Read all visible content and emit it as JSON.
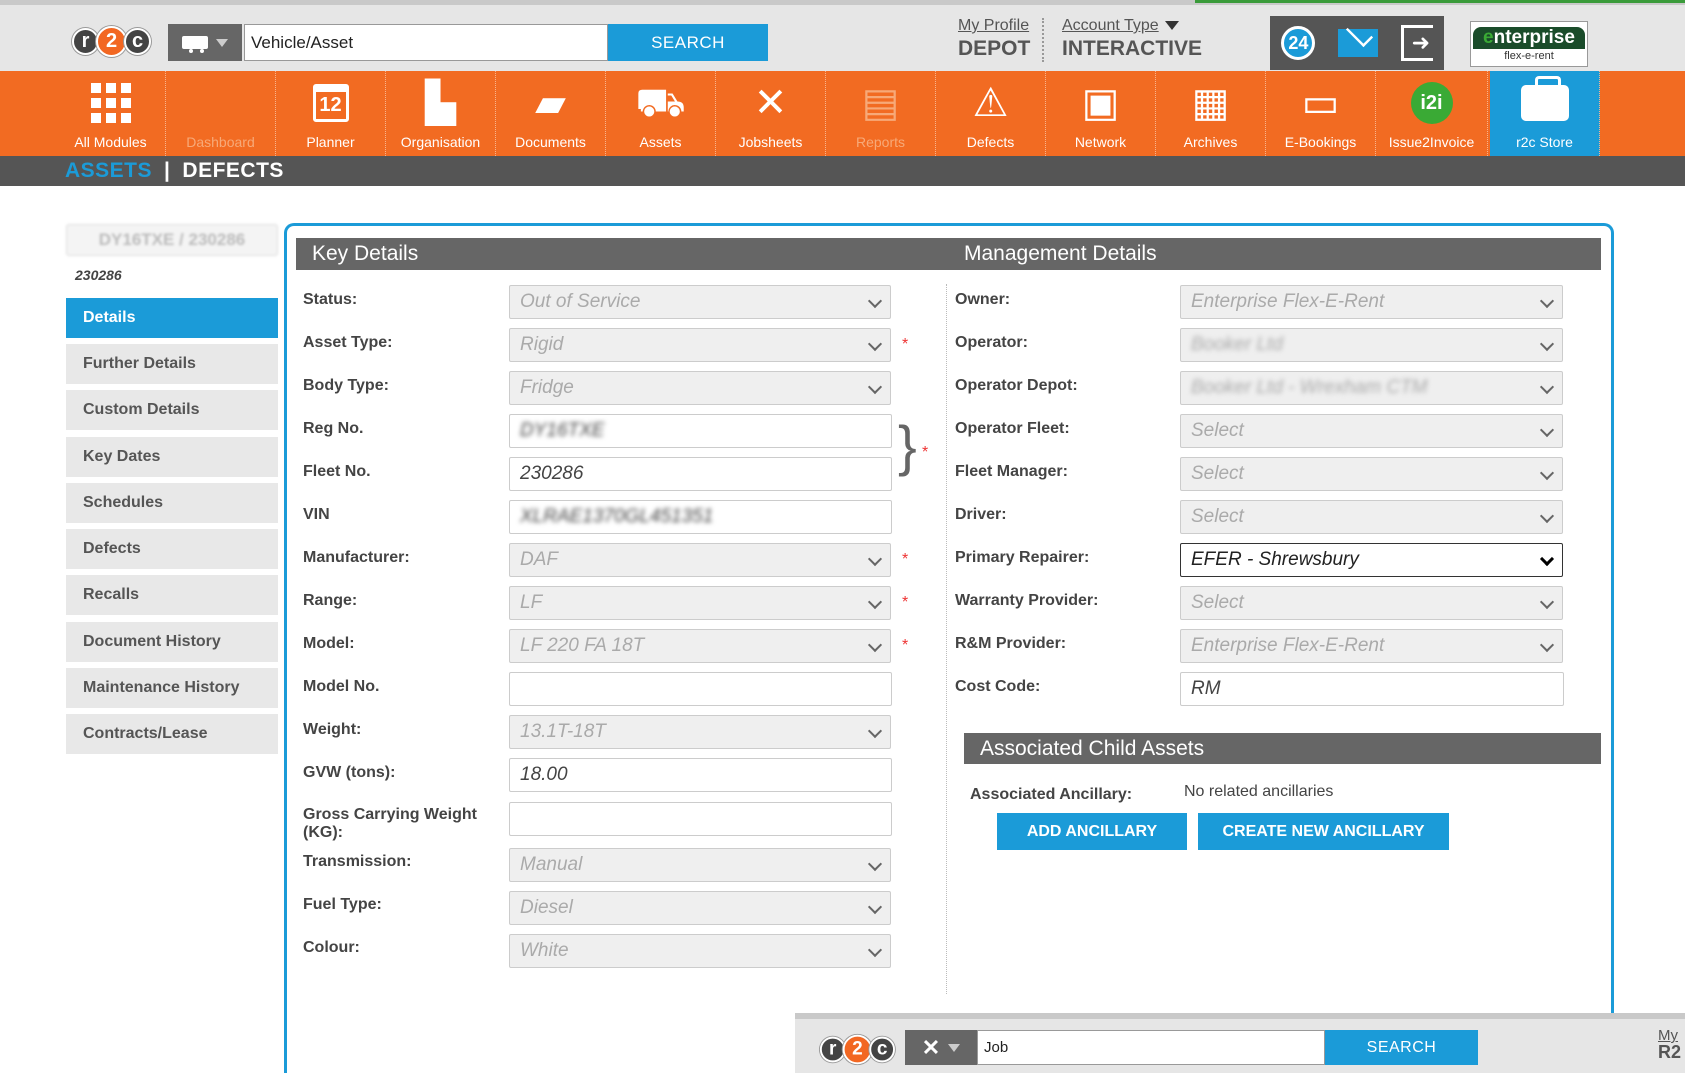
{
  "header": {
    "search_category_icon": "truck-icon",
    "search_value": "Vehicle/Asset",
    "search_button": "SEARCH",
    "my_profile": "My Profile",
    "depot": "DEPOT",
    "account_type": "Account Type",
    "account_value": "INTERACTIVE",
    "notifications_badge": "24",
    "partner_logo_main": "nterprise",
    "partner_logo_first": "e",
    "partner_logo_sub": "flex-e-rent"
  },
  "modules": [
    {
      "label": "All Modules",
      "icon": "grid-icon"
    },
    {
      "label": "Dashboard",
      "icon": "dashboard-icon"
    },
    {
      "label": "Planner",
      "icon": "calendar-icon",
      "icon_text": "12"
    },
    {
      "label": "Organisation",
      "icon": "buildings-icon"
    },
    {
      "label": "Documents",
      "icon": "folder-icon"
    },
    {
      "label": "Assets",
      "icon": "truck-icon"
    },
    {
      "label": "Jobsheets",
      "icon": "tools-icon"
    },
    {
      "label": "Reports",
      "icon": "clipboard-icon"
    },
    {
      "label": "Defects",
      "icon": "warning-icon"
    },
    {
      "label": "Network",
      "icon": "contacts-icon"
    },
    {
      "label": "Archives",
      "icon": "archive-icon"
    },
    {
      "label": "E-Bookings",
      "icon": "laptop-icon"
    },
    {
      "label": "Issue2Invoice",
      "icon": "i2i-icon",
      "icon_text": "i2i"
    },
    {
      "label": "r2c Store",
      "icon": "briefcase-icon"
    }
  ],
  "subnav": {
    "assets": "ASSETS",
    "separator": "|",
    "defects": "DEFECTS"
  },
  "asset": {
    "reg_fleet": "DY16TXE / 230286",
    "fleet_no": "230286"
  },
  "left_nav": [
    "Details",
    "Further Details",
    "Custom Details",
    "Key Dates",
    "Schedules",
    "Defects",
    "Recalls",
    "Document History",
    "Maintenance History",
    "Contracts/Lease"
  ],
  "key_details": {
    "title": "Key Details",
    "fields": [
      {
        "label": "Status:",
        "value": "Out of Service"
      },
      {
        "label": "Asset Type:",
        "value": "Rigid"
      },
      {
        "label": "Body Type:",
        "value": "Fridge"
      },
      {
        "label": "Reg No.",
        "value": "DY16TXE"
      },
      {
        "label": "Fleet No.",
        "value": "230286"
      },
      {
        "label": "VIN",
        "value": "XLRAE1370GL451351"
      },
      {
        "label": "Manufacturer:",
        "value": "DAF"
      },
      {
        "label": "Range:",
        "value": "LF"
      },
      {
        "label": "Model:",
        "value": "LF 220 FA 18T"
      },
      {
        "label": "Model No.",
        "value": ""
      },
      {
        "label": "Weight:",
        "value": "13.1T-18T"
      },
      {
        "label": "GVW (tons):",
        "value": "18.00"
      },
      {
        "label": "Gross Carrying Weight (KG):",
        "value": ""
      },
      {
        "label": "Transmission:",
        "value": "Manual"
      },
      {
        "label": "Fuel Type:",
        "value": "Diesel"
      },
      {
        "label": "Colour:",
        "value": "White"
      }
    ]
  },
  "management_details": {
    "title": "Management Details",
    "fields": [
      {
        "label": "Owner:",
        "value": "Enterprise Flex-E-Rent"
      },
      {
        "label": "Operator:",
        "value": "Booker Ltd"
      },
      {
        "label": "Operator Depot:",
        "value": "Booker Ltd - Wrexham CTM"
      },
      {
        "label": "Operator Fleet:",
        "value": "Select"
      },
      {
        "label": "Fleet Manager:",
        "value": "Select"
      },
      {
        "label": "Driver:",
        "value": "Select"
      },
      {
        "label": "Primary Repairer:",
        "value": "EFER - Shrewsbury"
      },
      {
        "label": "Warranty Provider:",
        "value": "Select"
      },
      {
        "label": "R&M Provider:",
        "value": "Enterprise Flex-E-Rent"
      },
      {
        "label": "Cost Code:",
        "value": "RM"
      }
    ]
  },
  "child_assets": {
    "title": "Associated Child Assets",
    "ancillary_label": "Associated Ancillary:",
    "ancillary_value": "No related ancillaries",
    "add_button": "ADD ANCILLARY",
    "create_button": "CREATE NEW ANCILLARY"
  },
  "required_marker": "*",
  "bottom_bar": {
    "search_category_icon": "wrench-icon",
    "search_value": "Job",
    "search_button": "SEARCH",
    "profile_fragment": "My",
    "account_fragment": "R2"
  }
}
